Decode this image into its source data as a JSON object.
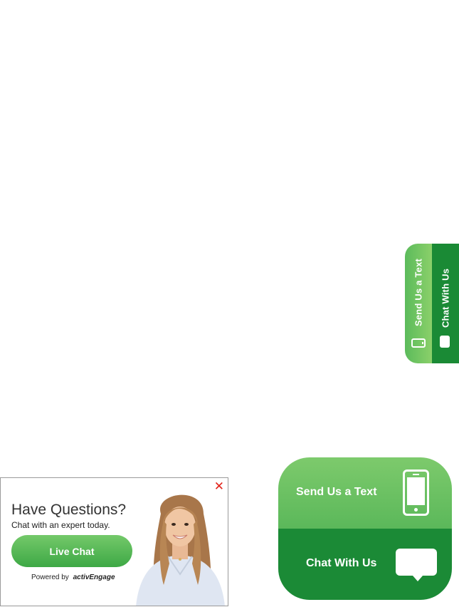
{
  "side_tab": {
    "text_label": "Send Us a Text",
    "chat_label": "Chat With Us",
    "text_icon": "phone-icon",
    "chat_icon": "chat-bubble-icon"
  },
  "big_widget": {
    "text_label": "Send Us a Text",
    "chat_label": "Chat With Us",
    "text_icon": "phone-icon",
    "chat_icon": "chat-bubble-icon"
  },
  "invite": {
    "close_label": "✕",
    "headline": "Have Questions?",
    "subline": "Chat with an expert today.",
    "button_label": "Live Chat",
    "powered_by": "Powered by",
    "brand": "activEngage"
  },
  "colors": {
    "green_light": "#7dca6c",
    "green_dark": "#1b8a36",
    "close_red": "#e2231a"
  }
}
